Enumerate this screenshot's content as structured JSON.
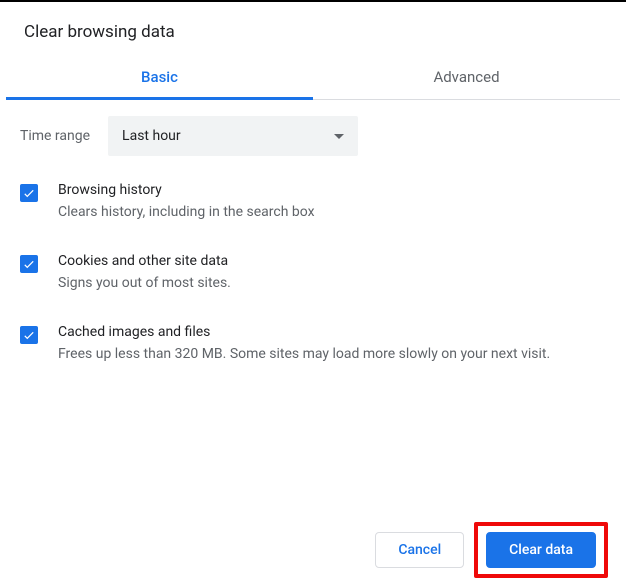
{
  "dialog": {
    "title": "Clear browsing data",
    "tabs": [
      {
        "label": "Basic",
        "active": true
      },
      {
        "label": "Advanced",
        "active": false
      }
    ],
    "timeRange": {
      "label": "Time range",
      "selected": "Last hour"
    },
    "options": [
      {
        "id": "browsing-history",
        "checked": true,
        "title": "Browsing history",
        "description": "Clears history, including in the search box"
      },
      {
        "id": "cookies",
        "checked": true,
        "title": "Cookies and other site data",
        "description": "Signs you out of most sites."
      },
      {
        "id": "cache",
        "checked": true,
        "title": "Cached images and files",
        "description": "Frees up less than 320 MB. Some sites may load more slowly on your next visit."
      }
    ],
    "buttons": {
      "cancel": "Cancel",
      "confirm": "Clear data"
    }
  }
}
